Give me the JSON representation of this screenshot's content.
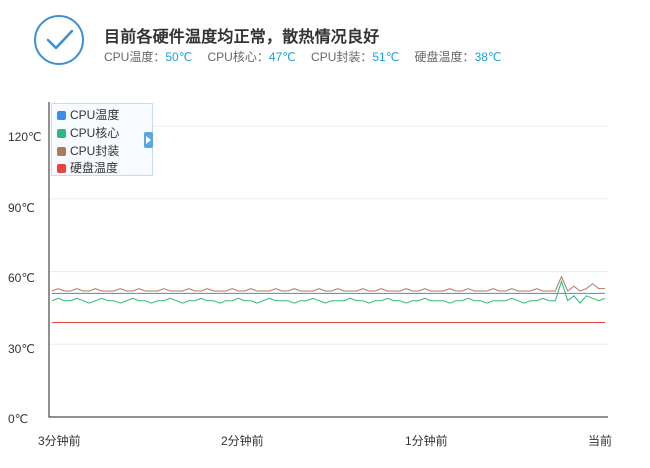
{
  "status": {
    "title": "目前各硬件温度均正常，散热情况良好",
    "metrics": [
      {
        "label": "CPU温度：",
        "value": "50℃"
      },
      {
        "label": "CPU核心：",
        "value": "47℃"
      },
      {
        "label": "CPU封装：",
        "value": "51℃"
      },
      {
        "label": "硬盘温度：",
        "value": "38℃"
      }
    ],
    "accent_color": "#3d8fd0",
    "value_color": "#1a9ee0"
  },
  "chart_data": {
    "type": "line",
    "y_ticks": [
      "0℃",
      "30℃",
      "60℃",
      "90℃",
      "120℃"
    ],
    "x_ticks": [
      "3分钟前",
      "2分钟前",
      "1分钟前",
      "当前"
    ],
    "ylim": [
      0,
      130
    ],
    "grid": true,
    "legend_position": "top-left",
    "series": [
      {
        "name": "CPU温度",
        "color": "#3a8ee6",
        "values": [
          51,
          51,
          51,
          51,
          51,
          51,
          51,
          51,
          51,
          51,
          51,
          51,
          51,
          51,
          51,
          51,
          51,
          51,
          51,
          51,
          51,
          51,
          51,
          51,
          51,
          51,
          51,
          51,
          51,
          51,
          51,
          51,
          51,
          51,
          51,
          51,
          51,
          51,
          51,
          51,
          51,
          51,
          51,
          51,
          51,
          51,
          51,
          51,
          51,
          51,
          51,
          51,
          51,
          51,
          51,
          51,
          51,
          51,
          51,
          51,
          51,
          51,
          51,
          51,
          51,
          51,
          51,
          51,
          51,
          51,
          51,
          51,
          51,
          51,
          51,
          51,
          51,
          51,
          51,
          51,
          51,
          51,
          51,
          51,
          51,
          51,
          51,
          51,
          51,
          51
        ]
      },
      {
        "name": "CPU核心",
        "color": "#2db87d",
        "values": [
          48,
          49,
          48,
          48,
          49,
          48,
          47,
          48,
          49,
          48,
          48,
          47,
          48,
          49,
          48,
          48,
          47,
          48,
          48,
          49,
          48,
          47,
          48,
          48,
          49,
          48,
          48,
          47,
          48,
          48,
          49,
          48,
          48,
          47,
          48,
          49,
          48,
          48,
          48,
          47,
          48,
          48,
          49,
          48,
          47,
          48,
          48,
          48,
          49,
          48,
          48,
          47,
          48,
          48,
          49,
          48,
          48,
          47,
          48,
          48,
          49,
          48,
          48,
          48,
          47,
          48,
          48,
          49,
          48,
          48,
          47,
          48,
          48,
          48,
          49,
          48,
          47,
          48,
          48,
          49,
          48,
          48,
          56,
          48,
          50,
          47,
          50,
          49,
          48,
          49
        ]
      },
      {
        "name": "CPU封装",
        "color": "#b07a5a",
        "values": [
          52,
          53,
          52,
          52,
          53,
          52,
          52,
          53,
          52,
          52,
          52,
          53,
          52,
          52,
          53,
          52,
          52,
          52,
          53,
          52,
          52,
          52,
          53,
          52,
          52,
          53,
          52,
          52,
          52,
          53,
          52,
          52,
          53,
          52,
          52,
          52,
          53,
          52,
          52,
          53,
          52,
          52,
          52,
          53,
          52,
          52,
          53,
          52,
          52,
          52,
          53,
          52,
          52,
          53,
          52,
          52,
          52,
          53,
          52,
          52,
          53,
          52,
          52,
          52,
          53,
          52,
          52,
          53,
          52,
          52,
          52,
          53,
          52,
          52,
          53,
          52,
          52,
          52,
          53,
          52,
          52,
          52,
          58,
          52,
          54,
          52,
          53,
          55,
          53,
          53
        ]
      },
      {
        "name": "硬盘温度",
        "color": "#e8463c",
        "values": [
          39,
          39,
          39,
          39,
          39,
          39,
          39,
          39,
          39,
          39,
          39,
          39,
          39,
          39,
          39,
          39,
          39,
          39,
          39,
          39,
          39,
          39,
          39,
          39,
          39,
          39,
          39,
          39,
          39,
          39,
          39,
          39,
          39,
          39,
          39,
          39,
          39,
          39,
          39,
          39,
          39,
          39,
          39,
          39,
          39,
          39,
          39,
          39,
          39,
          39,
          39,
          39,
          39,
          39,
          39,
          39,
          39,
          39,
          39,
          39,
          39,
          39,
          39,
          39,
          39,
          39,
          39,
          39,
          39,
          39,
          39,
          39,
          39,
          39,
          39,
          39,
          39,
          39,
          39,
          39,
          39,
          39,
          39,
          39,
          39,
          39,
          39,
          39,
          39,
          39
        ]
      }
    ]
  }
}
